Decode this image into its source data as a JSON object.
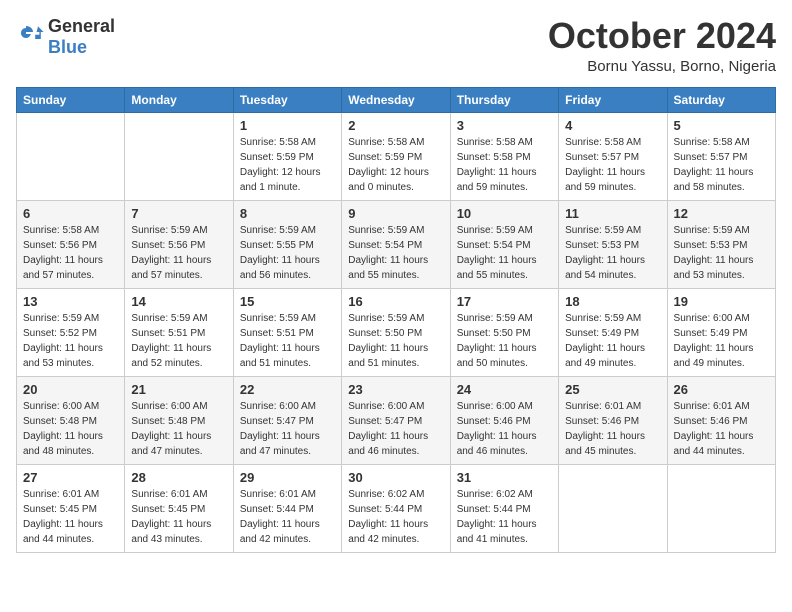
{
  "header": {
    "logo": {
      "text_general": "General",
      "text_blue": "Blue"
    },
    "title": "October 2024",
    "location": "Bornu Yassu, Borno, Nigeria"
  },
  "calendar": {
    "days_of_week": [
      "Sunday",
      "Monday",
      "Tuesday",
      "Wednesday",
      "Thursday",
      "Friday",
      "Saturday"
    ],
    "weeks": [
      [
        {
          "day": "",
          "info": ""
        },
        {
          "day": "",
          "info": ""
        },
        {
          "day": "1",
          "info": "Sunrise: 5:58 AM\nSunset: 5:59 PM\nDaylight: 12 hours\nand 1 minute."
        },
        {
          "day": "2",
          "info": "Sunrise: 5:58 AM\nSunset: 5:59 PM\nDaylight: 12 hours\nand 0 minutes."
        },
        {
          "day": "3",
          "info": "Sunrise: 5:58 AM\nSunset: 5:58 PM\nDaylight: 11 hours\nand 59 minutes."
        },
        {
          "day": "4",
          "info": "Sunrise: 5:58 AM\nSunset: 5:57 PM\nDaylight: 11 hours\nand 59 minutes."
        },
        {
          "day": "5",
          "info": "Sunrise: 5:58 AM\nSunset: 5:57 PM\nDaylight: 11 hours\nand 58 minutes."
        }
      ],
      [
        {
          "day": "6",
          "info": "Sunrise: 5:58 AM\nSunset: 5:56 PM\nDaylight: 11 hours\nand 57 minutes."
        },
        {
          "day": "7",
          "info": "Sunrise: 5:59 AM\nSunset: 5:56 PM\nDaylight: 11 hours\nand 57 minutes."
        },
        {
          "day": "8",
          "info": "Sunrise: 5:59 AM\nSunset: 5:55 PM\nDaylight: 11 hours\nand 56 minutes."
        },
        {
          "day": "9",
          "info": "Sunrise: 5:59 AM\nSunset: 5:54 PM\nDaylight: 11 hours\nand 55 minutes."
        },
        {
          "day": "10",
          "info": "Sunrise: 5:59 AM\nSunset: 5:54 PM\nDaylight: 11 hours\nand 55 minutes."
        },
        {
          "day": "11",
          "info": "Sunrise: 5:59 AM\nSunset: 5:53 PM\nDaylight: 11 hours\nand 54 minutes."
        },
        {
          "day": "12",
          "info": "Sunrise: 5:59 AM\nSunset: 5:53 PM\nDaylight: 11 hours\nand 53 minutes."
        }
      ],
      [
        {
          "day": "13",
          "info": "Sunrise: 5:59 AM\nSunset: 5:52 PM\nDaylight: 11 hours\nand 53 minutes."
        },
        {
          "day": "14",
          "info": "Sunrise: 5:59 AM\nSunset: 5:51 PM\nDaylight: 11 hours\nand 52 minutes."
        },
        {
          "day": "15",
          "info": "Sunrise: 5:59 AM\nSunset: 5:51 PM\nDaylight: 11 hours\nand 51 minutes."
        },
        {
          "day": "16",
          "info": "Sunrise: 5:59 AM\nSunset: 5:50 PM\nDaylight: 11 hours\nand 51 minutes."
        },
        {
          "day": "17",
          "info": "Sunrise: 5:59 AM\nSunset: 5:50 PM\nDaylight: 11 hours\nand 50 minutes."
        },
        {
          "day": "18",
          "info": "Sunrise: 5:59 AM\nSunset: 5:49 PM\nDaylight: 11 hours\nand 49 minutes."
        },
        {
          "day": "19",
          "info": "Sunrise: 6:00 AM\nSunset: 5:49 PM\nDaylight: 11 hours\nand 49 minutes."
        }
      ],
      [
        {
          "day": "20",
          "info": "Sunrise: 6:00 AM\nSunset: 5:48 PM\nDaylight: 11 hours\nand 48 minutes."
        },
        {
          "day": "21",
          "info": "Sunrise: 6:00 AM\nSunset: 5:48 PM\nDaylight: 11 hours\nand 47 minutes."
        },
        {
          "day": "22",
          "info": "Sunrise: 6:00 AM\nSunset: 5:47 PM\nDaylight: 11 hours\nand 47 minutes."
        },
        {
          "day": "23",
          "info": "Sunrise: 6:00 AM\nSunset: 5:47 PM\nDaylight: 11 hours\nand 46 minutes."
        },
        {
          "day": "24",
          "info": "Sunrise: 6:00 AM\nSunset: 5:46 PM\nDaylight: 11 hours\nand 46 minutes."
        },
        {
          "day": "25",
          "info": "Sunrise: 6:01 AM\nSunset: 5:46 PM\nDaylight: 11 hours\nand 45 minutes."
        },
        {
          "day": "26",
          "info": "Sunrise: 6:01 AM\nSunset: 5:46 PM\nDaylight: 11 hours\nand 44 minutes."
        }
      ],
      [
        {
          "day": "27",
          "info": "Sunrise: 6:01 AM\nSunset: 5:45 PM\nDaylight: 11 hours\nand 44 minutes."
        },
        {
          "day": "28",
          "info": "Sunrise: 6:01 AM\nSunset: 5:45 PM\nDaylight: 11 hours\nand 43 minutes."
        },
        {
          "day": "29",
          "info": "Sunrise: 6:01 AM\nSunset: 5:44 PM\nDaylight: 11 hours\nand 42 minutes."
        },
        {
          "day": "30",
          "info": "Sunrise: 6:02 AM\nSunset: 5:44 PM\nDaylight: 11 hours\nand 42 minutes."
        },
        {
          "day": "31",
          "info": "Sunrise: 6:02 AM\nSunset: 5:44 PM\nDaylight: 11 hours\nand 41 minutes."
        },
        {
          "day": "",
          "info": ""
        },
        {
          "day": "",
          "info": ""
        }
      ]
    ]
  }
}
